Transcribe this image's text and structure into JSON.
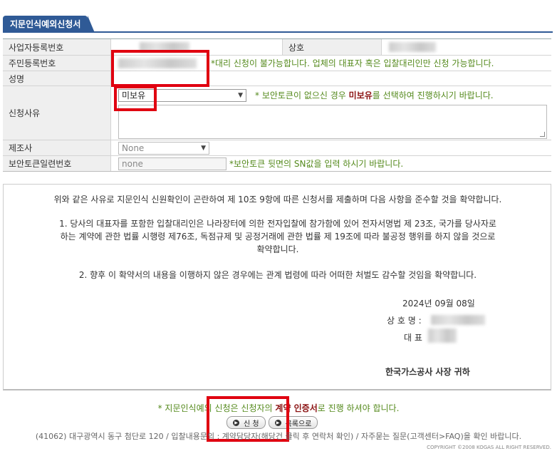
{
  "header": {
    "title": "지문인식예외신청서"
  },
  "form": {
    "biz_reg_label": "사업자등록번호",
    "company_label": "상호",
    "resident_label": "주민등록번호",
    "resident_note": "*대리 신청이 불가능합니다. 업체의 대표자 혹은 입찰대리인만 신청 가능합니다.",
    "name_label": "성명",
    "reason_label": "신청사유",
    "reason_selected": "미보유",
    "reason_note_pre": "* 보안토큰이 없으신 경우 ",
    "reason_note_em": "미보유",
    "reason_note_post": "를 선택하여 진행하시기 바랍니다.",
    "maker_label": "제조사",
    "maker_selected": "None",
    "serial_label": "보안토큰일련번호",
    "serial_value": "none",
    "serial_note": "*보안토큰 뒷면의 SN값을 입력 하시기 바랍니다."
  },
  "agreement": {
    "intro": "위와 같은 사유로 지문인식 신원확인이 곤란하여 제 10조 9항에 따른 신청서를 제출하며 다음 사항을 준수할 것을 확약합니다.",
    "item1_line1": "1. 당사의 대표자를 포함한 입찰대리인은 나라장터에 의한 전자입찰에 참가함에 있어 전자서명법 제 23조, 국가를 당사자로",
    "item1_line2": "하는 계약에 관한 법률 시행령 제76조, 독점규제 및 공정거래에 관한 법률 제 19조에 따라 불공정 행위를 하지 않을 것으로",
    "item1_line3": "확약합니다.",
    "item2": "2. 향후 이 확약서의 내용을 이행하지 않은 경우에는 관계 법령에 따라 어떠한 처벌도 감수할 것임을 확약합니다.",
    "date": "2024년 09월 08일",
    "company_name_label": "상 호 명 :",
    "rep_label": "대 표",
    "recipient": "한국가스공사 사장 귀하"
  },
  "footer": {
    "note_pre": "* 지문인식예외 신청은 신청자의 ",
    "note_em": "계약 인증서",
    "note_post": "로 진행 하셔야 합니다.",
    "apply_button": "신 청",
    "list_button": "목록으로",
    "address": "(41062) 대구광역시 동구 첨단로 120 / 입찰내용문의 : 계약담당자(해당건 클릭 후 연락처 확인) / 자주묻는 질문(고객센터>FAQ)을 확인 바랍니다.",
    "copyright": "COPYRIGHT ©2008 KOGAS ALL RIGHT RESERVED."
  },
  "colors": {
    "accent": "#2f5a96",
    "note_green": "#558a1d",
    "emphasis": "#8b1212",
    "highlight_box": "#e00010"
  }
}
